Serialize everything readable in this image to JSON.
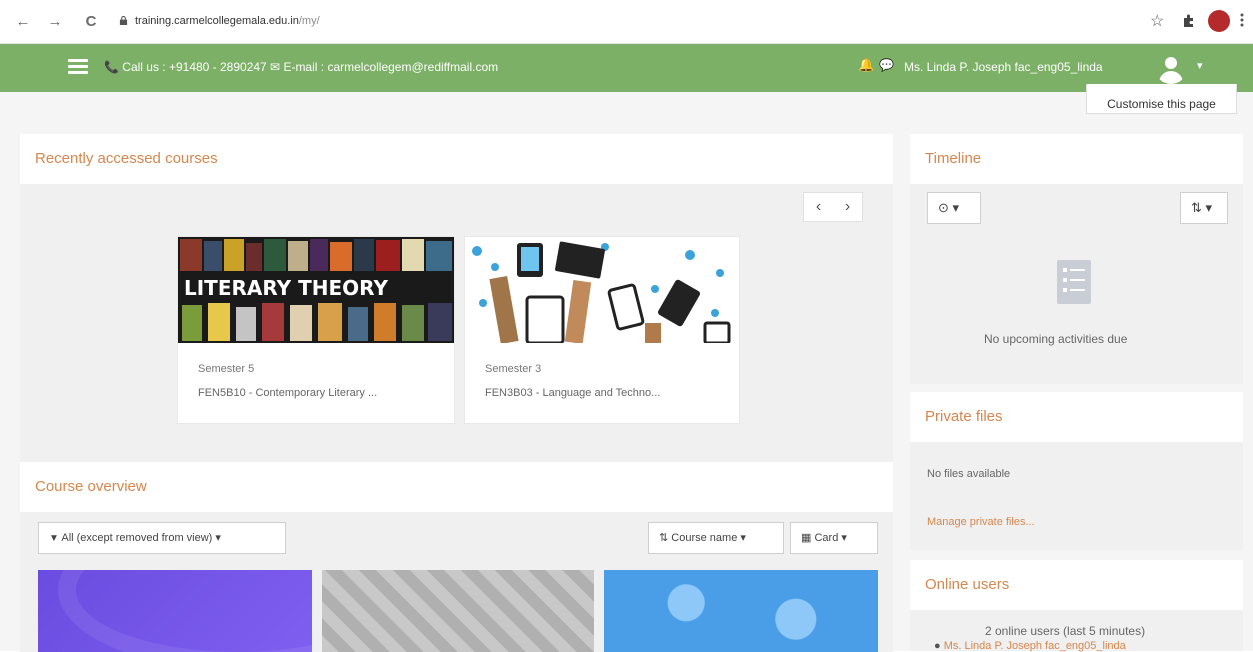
{
  "browser": {
    "back_icon": "←",
    "forward_icon": "→",
    "reload_icon": "C",
    "url_host": "training.carmelcollegemala.edu.in",
    "url_path": "/my/",
    "star_icon": "☆"
  },
  "navbar": {
    "contact": "📞 Call us : +91480 - 2890247 ✉ E-mail : carmelcollegem@rediffmail.com",
    "user_name": "Ms. Linda P. Joseph fac_eng05_linda",
    "caret": "▾",
    "bell_icon": "🔔",
    "chat_icon": "💬"
  },
  "page": {
    "customise_label": "Customise this page"
  },
  "recent": {
    "title": "Recently accessed courses",
    "prev": "‹",
    "next": "›",
    "courses": [
      {
        "image_text": "LITERARY THEORY",
        "semester": "Semester 5",
        "name": "FEN5B10 - Contemporary Literary ..."
      },
      {
        "image_text": "",
        "semester": "Semester 3",
        "name": "FEN3B03 - Language and Techno..."
      }
    ]
  },
  "overview": {
    "title": "Course overview",
    "filter_label": "All (except removed from view)",
    "sort_label": "Course name",
    "view_label": "Card",
    "caret": "▾"
  },
  "timeline": {
    "title": "Timeline",
    "empty": "No upcoming activities due"
  },
  "private_files": {
    "title": "Private files",
    "empty": "No files available",
    "manage": "Manage private files..."
  },
  "online": {
    "title": "Online users",
    "summary": "2 online users (last 5 minutes)",
    "first_user": "Ms. Linda P. Joseph fac_eng05_linda"
  },
  "colors": {
    "navbar": "#7cb066",
    "accent": "#d4874e"
  }
}
